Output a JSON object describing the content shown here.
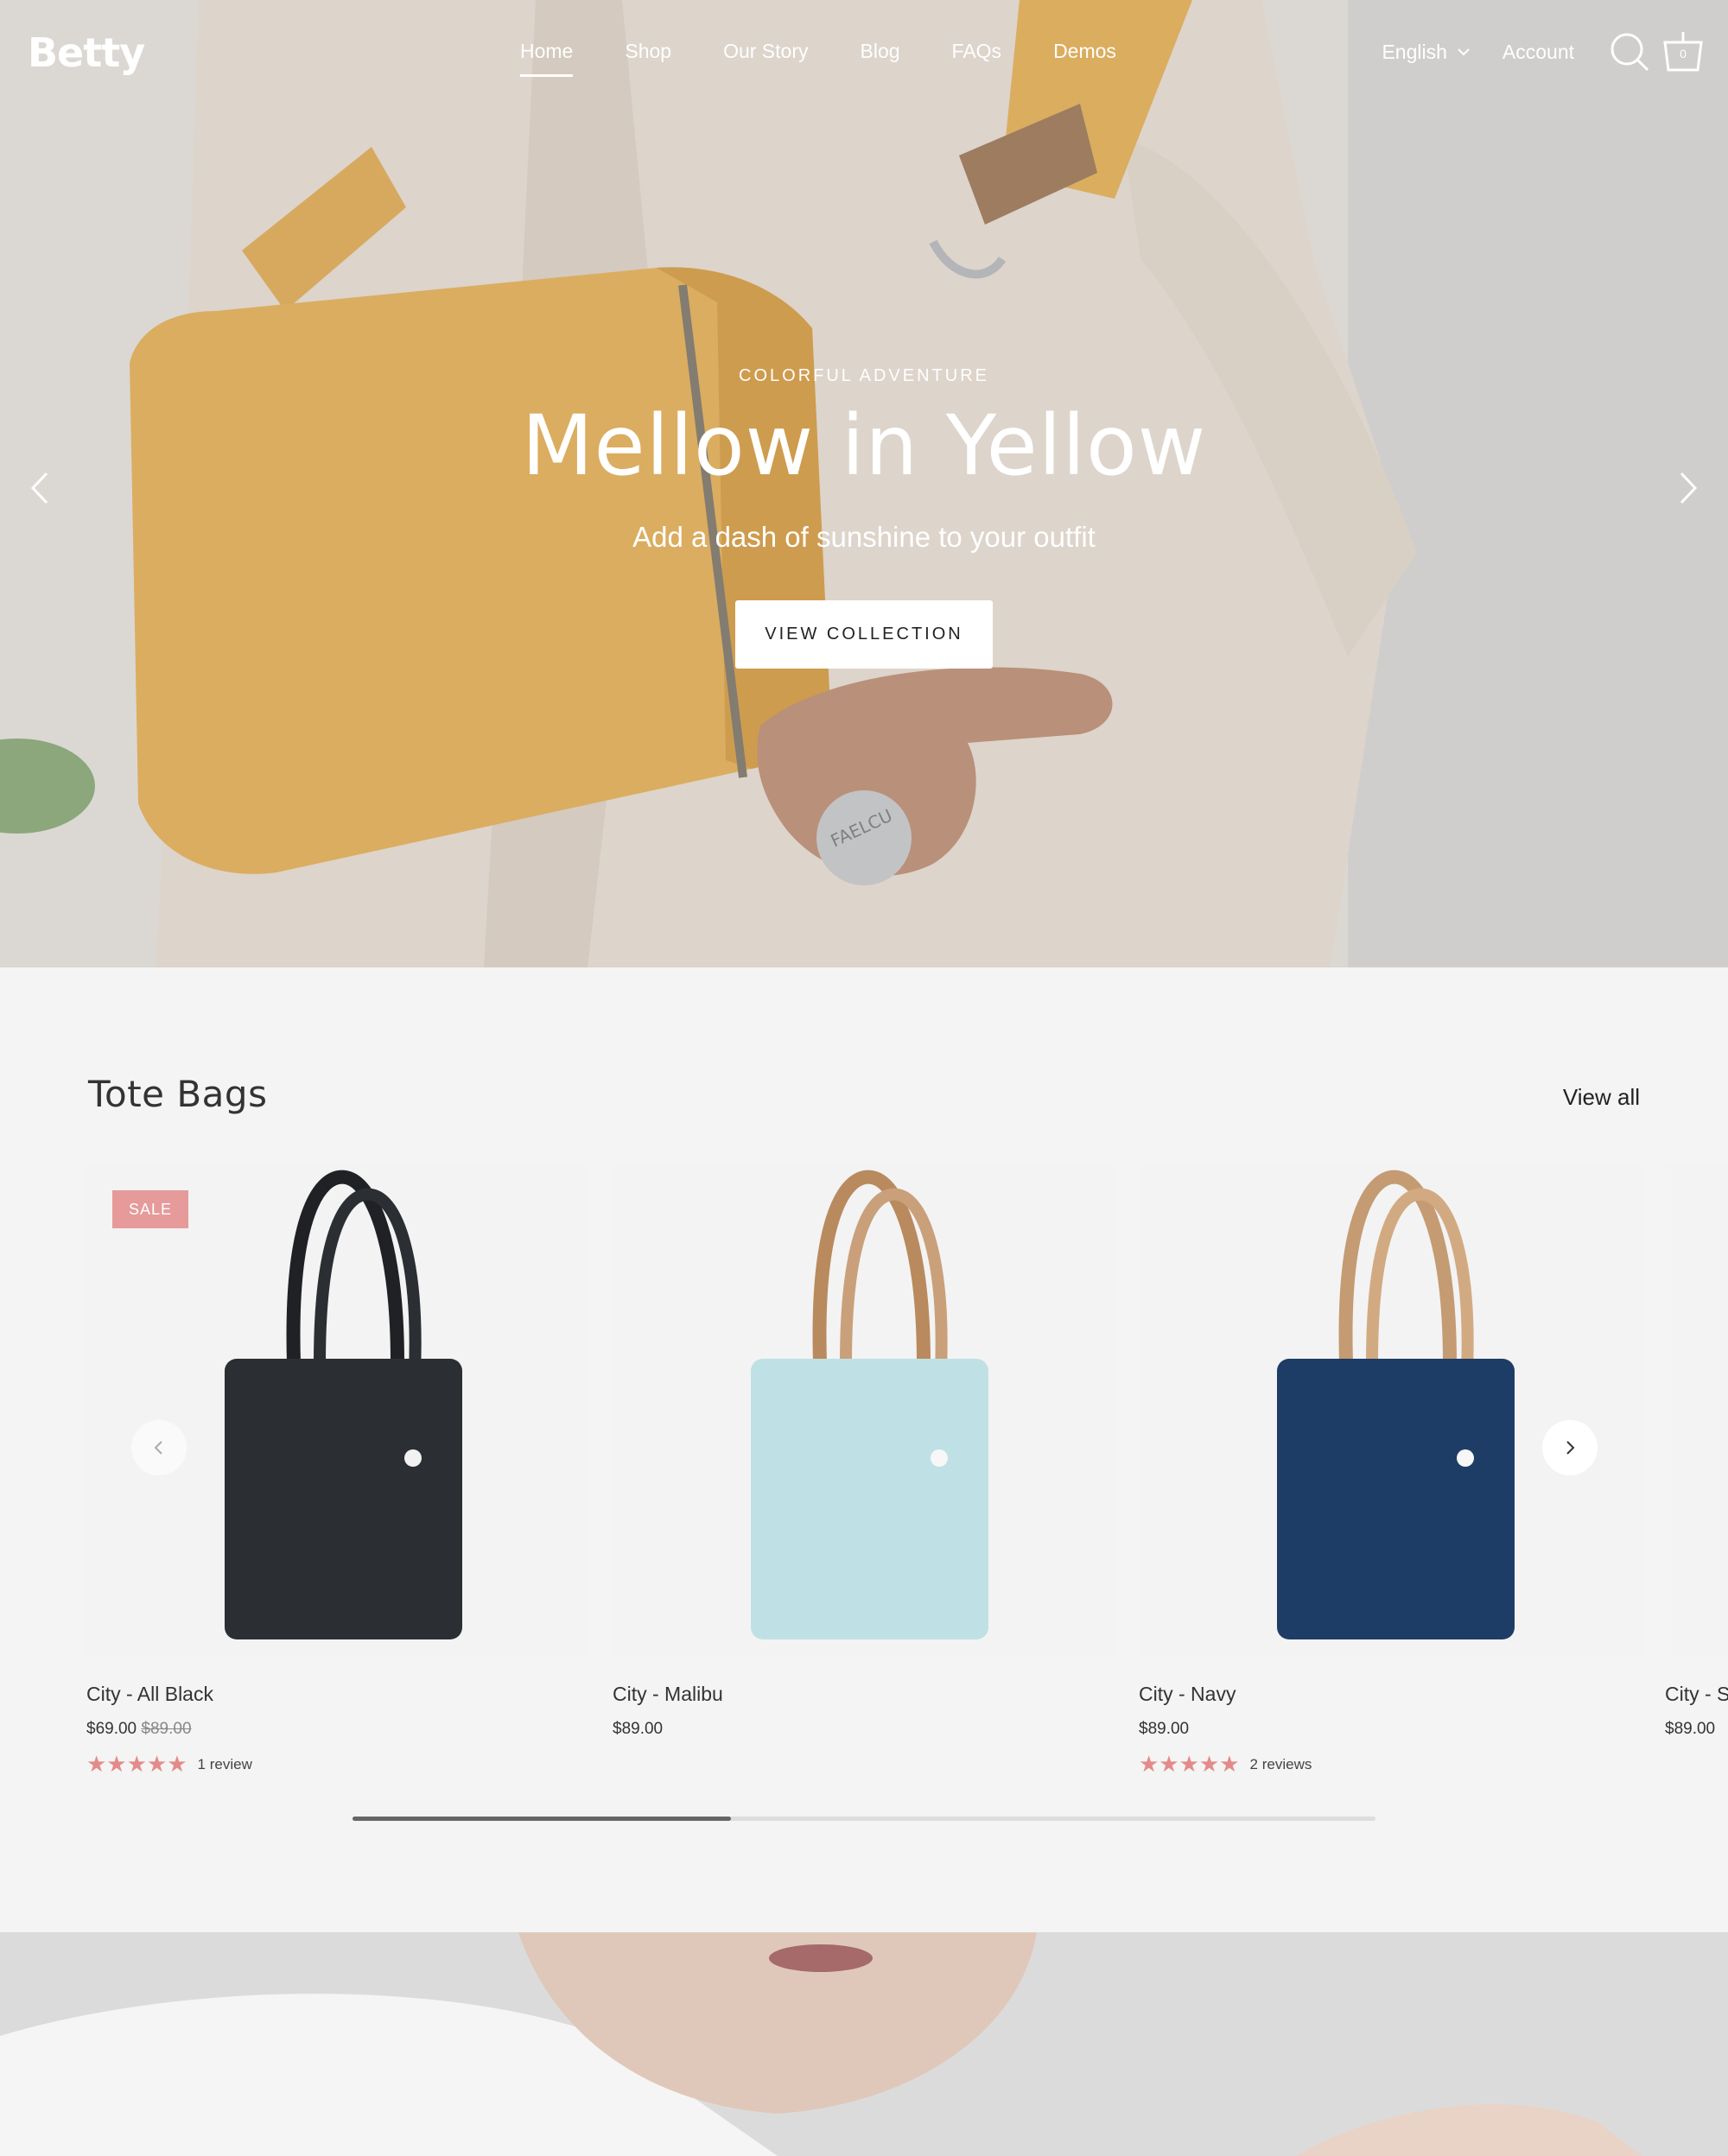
{
  "brand": {
    "logo_text": "Betty"
  },
  "nav": {
    "items": [
      {
        "label": "Home",
        "active": true
      },
      {
        "label": "Shop"
      },
      {
        "label": "Our Story"
      },
      {
        "label": "Blog"
      },
      {
        "label": "FAQs"
      },
      {
        "label": "Demos"
      }
    ],
    "language": "English",
    "account": "Account",
    "cart_count": "0"
  },
  "hero": {
    "eyebrow": "COLORFUL ADVENTURE",
    "headline": "Mellow in Yellow",
    "subhead": "Add a dash of sunshine to your outfit",
    "cta": "VIEW COLLECTION",
    "tag_text": "FAELCU"
  },
  "collection": {
    "title": "Tote Bags",
    "view_all": "View all",
    "products": [
      {
        "name": "City - All Black",
        "price": "$69.00",
        "compare_price": "$89.00",
        "badge": "SALE",
        "rating": 5,
        "reviews": "1 review",
        "body_color": "#2b2e33",
        "handle_color": "#1f2125"
      },
      {
        "name": "City - Malibu",
        "price": "$89.00",
        "compare_price": "",
        "badge": "",
        "rating": null,
        "reviews": "",
        "body_color": "#bfe1e5",
        "handle_color": "#b98a5e"
      },
      {
        "name": "City - Navy",
        "price": "$89.00",
        "compare_price": "",
        "badge": "",
        "rating": 5,
        "reviews": "2 reviews",
        "body_color": "#1e3d66",
        "handle_color": "#c49b72"
      },
      {
        "name": "City - S",
        "price": "$89.00"
      }
    ],
    "scroll_progress": 0.37
  },
  "colors": {
    "accent_pink": "#e69a9a",
    "star": "#e58a8a",
    "hero_bag": "#e9b867"
  }
}
